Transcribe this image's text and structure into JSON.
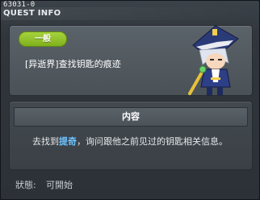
{
  "window": {
    "quest_id": "63031-0",
    "title": "QUEST INFO"
  },
  "quest": {
    "badge": "一般",
    "name": "[异逝界]查找钥匙的痕迹"
  },
  "content": {
    "header": "内容",
    "text_before": "去找到",
    "npc": "提奇",
    "text_after": "，询问跟他之前见过的钥匙相关信息。"
  },
  "status": {
    "label": "狀態:",
    "value": "可開始"
  },
  "colors": {
    "badge": "#8fc02a",
    "npc_highlight": "#6fc3ff"
  },
  "icons": {
    "portrait": "npc-portrait-icon"
  }
}
